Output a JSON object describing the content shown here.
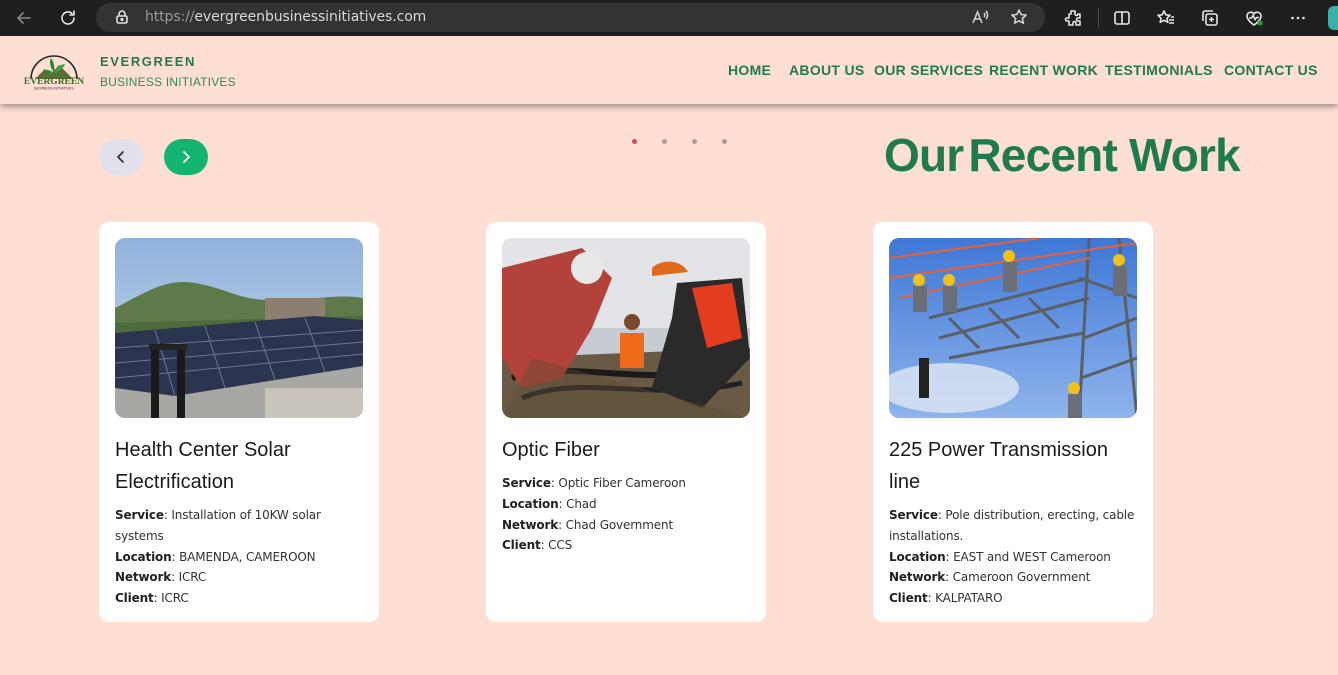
{
  "browser": {
    "url_protocol": "https://",
    "url_host": "evergreenbusinessinitiatives.com",
    "icons": [
      "back-icon",
      "refresh-icon",
      "lock-icon",
      "read-aloud-icon",
      "favorite-star-icon",
      "extensions-icon",
      "split-screen-icon",
      "favorites-icon",
      "collections-icon",
      "health-icon",
      "more-icon"
    ]
  },
  "header": {
    "brand_title": "EVERGREEN",
    "brand_subtitle": "BUSINESS INITIATIVES",
    "logo_text": "EVERGREEN",
    "logo_subtext": "BUSINESS INITIATIVES",
    "nav": [
      "HOME",
      "ABOUT US",
      "OUR SERVICES",
      "RECENT WORK",
      "TESTIMONIALS",
      "CONTACT US"
    ]
  },
  "carousel": {
    "prev_icon": "chevron-left-icon",
    "next_icon": "chevron-right-icon",
    "dots": 4,
    "active_dot": 0
  },
  "section": {
    "title_part1": "Our",
    "title_part2": "Recent Work"
  },
  "projects": [
    {
      "title": "Health Center Solar Electrification",
      "image": "solar-panels-photo",
      "service_label": "Service",
      "service": "Installation of 10KW solar systems",
      "location_label": "Location",
      "location": "BAMENDA, CAMEROON",
      "network_label": "Network",
      "network": "ICRC",
      "client_label": "Client",
      "client": "ICRC"
    },
    {
      "title": "Optic Fiber",
      "image": "optic-fiber-workers-photo",
      "service_label": "Service",
      "service": "Optic Fiber Cameroon",
      "location_label": "Location",
      "location": "Chad",
      "network_label": "Network",
      "network": "Chad Government",
      "client_label": "Client",
      "client": "CCS"
    },
    {
      "title": "225 Power Transmission line",
      "image": "power-tower-workers-photo",
      "service_label": "Service",
      "service": "Pole distribution, erecting, cable installations.",
      "location_label": "Location",
      "location": "EAST and WEST Cameroon",
      "network_label": "Network",
      "network": "Cameroon Government",
      "client_label": "Client",
      "client": "KALPATARO"
    }
  ],
  "colors": {
    "background": "#ffdfd3",
    "brand_green": "#1f7a4d",
    "accent_button": "#13b371",
    "active_dot": "#d44b5a"
  }
}
